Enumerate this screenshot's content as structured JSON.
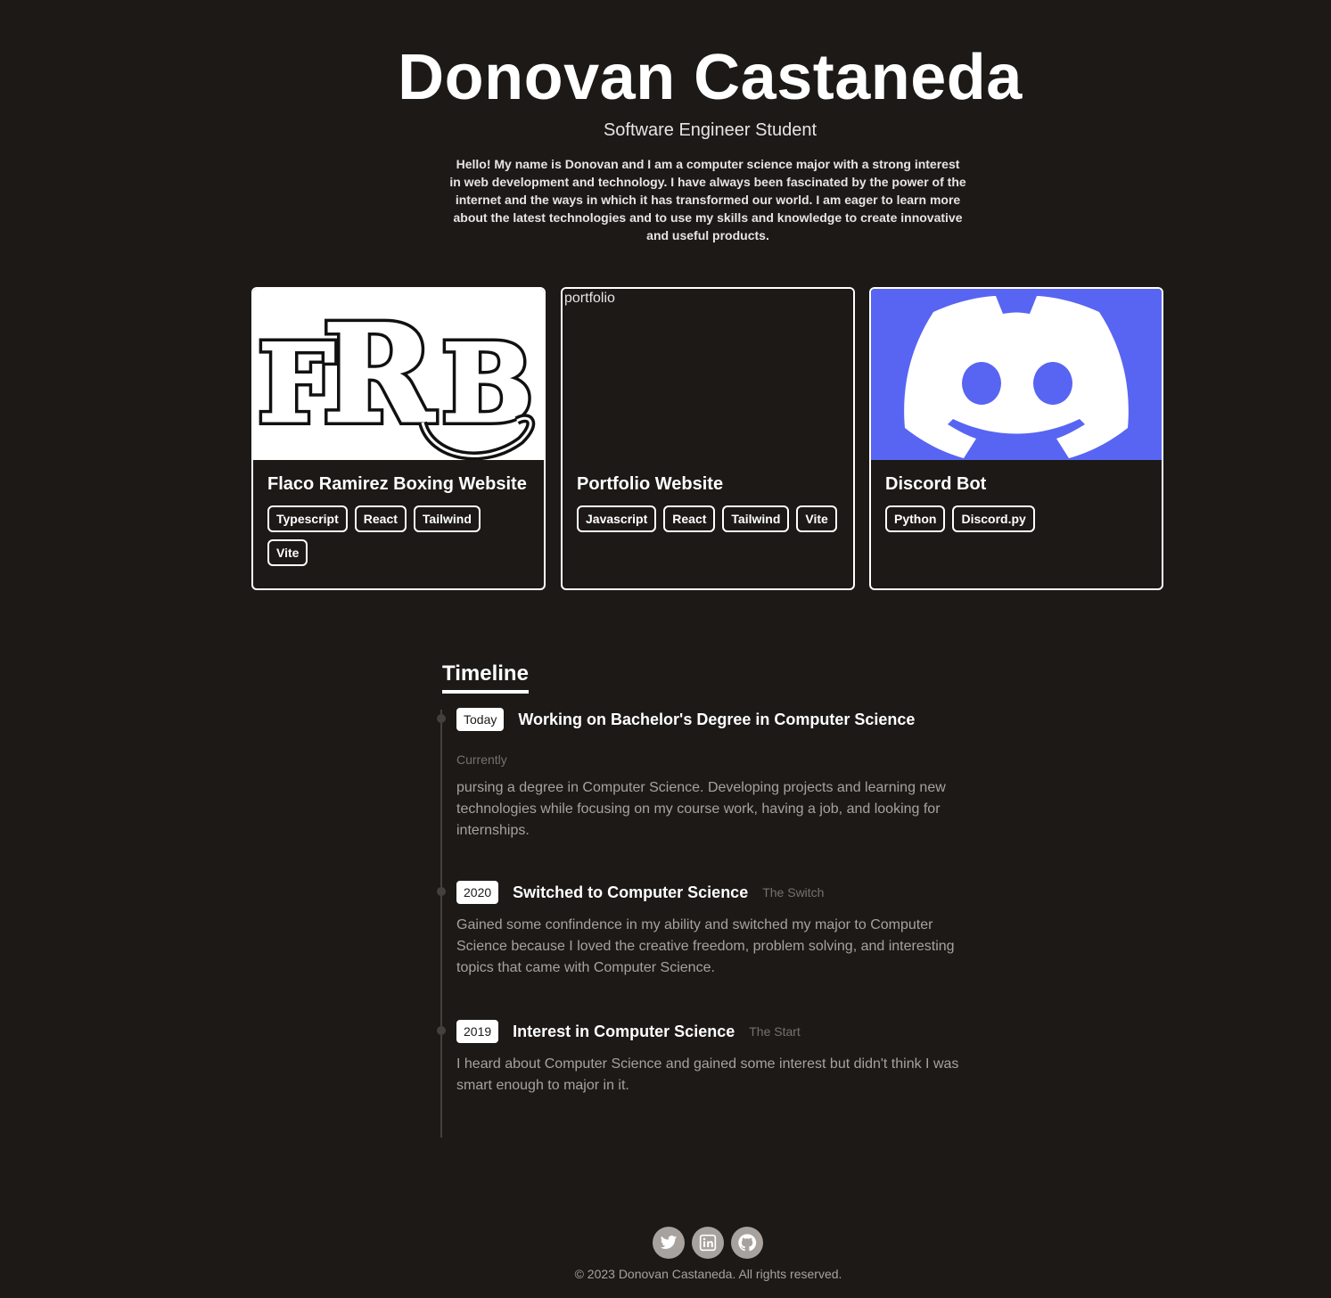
{
  "hero": {
    "name": "Donovan Castaneda",
    "subtitle": "Software Engineer Student",
    "bio": "Hello! My name is Donovan and I am a computer science major with a strong interest in web development and technology. I have always been fascinated by the power of the internet and the ways in which it has transformed our world. I am eager to learn more about the latest technologies and to use my skills and knowledge to create innovative and useful products."
  },
  "projects": [
    {
      "title": "Flaco Ramirez Boxing Website",
      "image_text": "FRB",
      "tags": [
        "Typescript",
        "React",
        "Tailwind",
        "Vite"
      ]
    },
    {
      "title": "Portfolio Website",
      "image_alt": "portfolio",
      "tags": [
        "Javascript",
        "React",
        "Tailwind",
        "Vite"
      ]
    },
    {
      "title": "Discord Bot",
      "tags": [
        "Python",
        "Discord.py"
      ]
    }
  ],
  "timeline": {
    "heading": "Timeline",
    "items": [
      {
        "badge": "Today",
        "title": "Working on Bachelor's Degree in Computer Science",
        "subtitle": "Currently",
        "description": "pursing a degree in Computer Science. Developing projects and learning new technologies while focusing on my course work, having a job, and looking for internships."
      },
      {
        "badge": "2020",
        "title": "Switched to Computer Science",
        "subtitle": "The Switch",
        "description": "Gained some confindence in my ability and switched my major to Computer Science because I loved the creative freedom, problem solving, and interesting topics that came with Computer Science."
      },
      {
        "badge": "2019",
        "title": "Interest in Computer Science",
        "subtitle": "The Start",
        "description": "I heard about Computer Science and gained some interest but didn't think I was smart enough to major in it."
      }
    ]
  },
  "socials": [
    "twitter-icon",
    "linkedin-icon",
    "github-icon"
  ],
  "footer": {
    "copyright": "© 2023 Donovan Castaneda. All rights reserved."
  },
  "colors": {
    "background": "#1c1917",
    "discord": "#5865f2",
    "muted": "#a8a29e"
  }
}
